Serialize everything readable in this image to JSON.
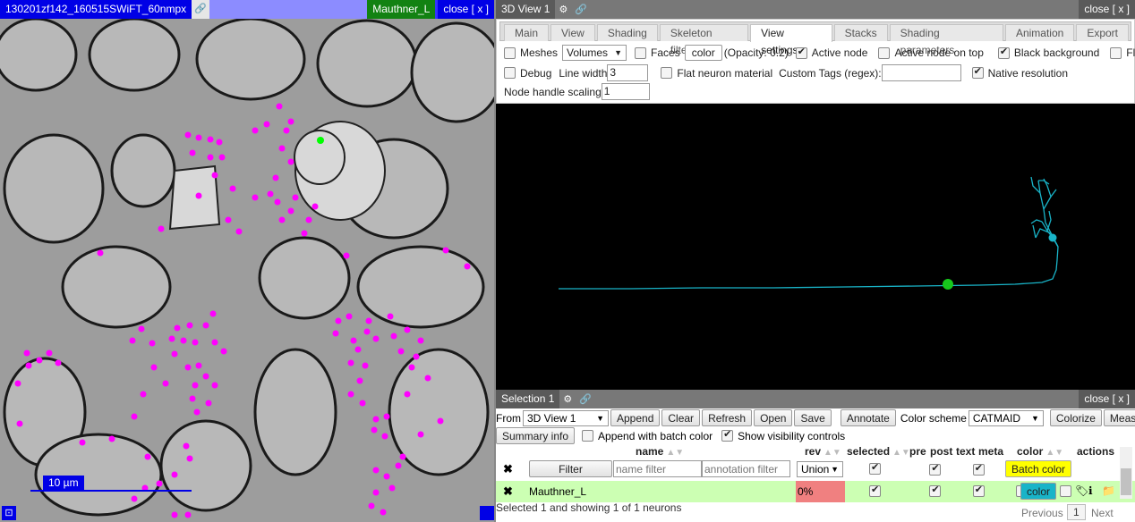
{
  "stack_view": {
    "stack_title": "130201zf142_160515SWiFT_60nmpx",
    "link_icon": "link-icon",
    "neuron_tag": "Mauthner_L",
    "close_label": "close [ x ]",
    "scalebar_label": "10 µm",
    "synapse_color": "#ff00ff",
    "active_node_color": "#00ff00"
  },
  "view3d": {
    "title": "3D View 1",
    "close_label": "close [ x ]",
    "tabs": [
      "Main",
      "View",
      "Shading",
      "Skeleton filters",
      "View settings",
      "Stacks",
      "Shading parameters",
      "Animation",
      "Export"
    ],
    "active_tab": "View settings",
    "settings": {
      "meshes_label": "Meshes",
      "volumes_select": "Volumes",
      "faces_label": "Faces",
      "color_button": "color",
      "opacity_text": "(Opacity: 0.2)",
      "active_node_label": "Active node",
      "active_node_on_top_label": "Active node on top",
      "black_background_label": "Black background",
      "floor_label": "Floor",
      "debug_label": "Debug",
      "line_width_label": "Line width",
      "line_width_value": "3",
      "flat_material_label": "Flat neuron material",
      "custom_tags_label": "Custom Tags (regex):",
      "custom_tags_value": "",
      "native_resolution_label": "Native resolution",
      "node_handle_scaling_label": "Node handle scaling",
      "node_handle_scaling_value": "1"
    },
    "skeleton_color": "#19b4c8",
    "node_color": "#17c81c"
  },
  "selection": {
    "title": "Selection 1",
    "close_label": "close [ x ]",
    "from_label": "From",
    "from_value": "3D View 1",
    "append_label": "Append",
    "clear_label": "Clear",
    "refresh_label": "Refresh",
    "open_label": "Open",
    "save_label": "Save",
    "annotate_label": "Annotate",
    "color_scheme_label": "Color scheme",
    "color_scheme_value": "CATMAID",
    "colorize_label": "Colorize",
    "measure_label": "Measure",
    "summary_info_label": "Summary info",
    "append_batch_label": "Append with batch color",
    "show_visibility_label": "Show visibility controls",
    "columns": {
      "name": "name",
      "rev": "rev",
      "selected": "selected",
      "pre": "pre",
      "post": "post",
      "text": "text",
      "meta": "meta",
      "color": "color",
      "actions": "actions"
    },
    "filter_button": "Filter",
    "name_filter_placeholder": "name filter",
    "annotation_filter_placeholder": "annotation filter",
    "union_value": "Union",
    "batch_color_label": "Batch color",
    "rows": [
      {
        "name": "Mauthner_L",
        "rev": "0%",
        "color_label": "color"
      }
    ],
    "status": "Selected 1 and showing 1 of 1 neurons",
    "previous_label": "Previous",
    "page": "1",
    "next_label": "Next"
  }
}
